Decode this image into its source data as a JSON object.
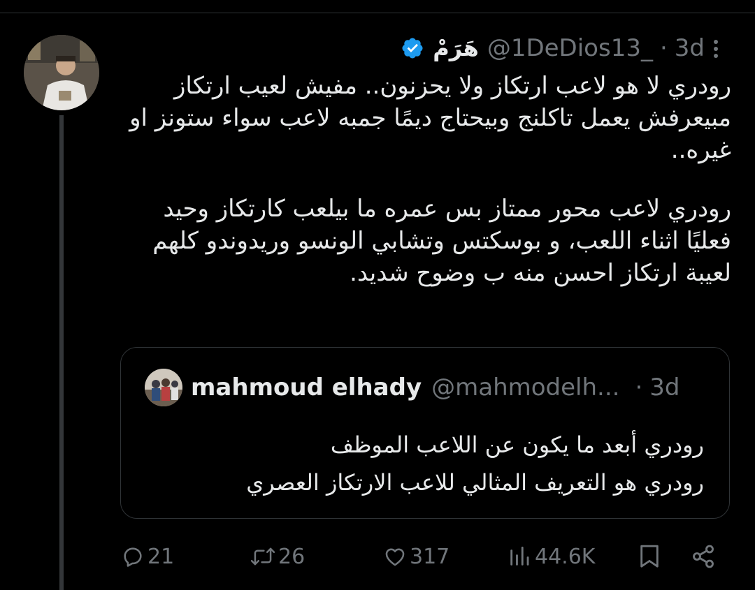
{
  "tweet": {
    "author": {
      "display_name": "هَرَمْ",
      "handle": "@1DeDios13_",
      "verified": true
    },
    "separator": "·",
    "time": "3d",
    "paragraphs": [
      "رودري لا هو لاعب ارتكاز ولا يحزنون.. مفيش لعيب ارتكاز مبيعرفش يعمل تاكلنج وبيحتاج ديمًا جمبه لاعب سواء ستونز او غيره..",
      "رودري لاعب محور ممتاز بس عمره ما بيلعب كارتكاز وحيد فعليًا اثناء اللعب، و بوسكتس وتشابي الونسو وريدوندو كلهم لعيبة ارتكاز احسن منه ب وضوح شديد."
    ]
  },
  "quote": {
    "name": "mahmoud elhady",
    "handle": "@mahmodelh...",
    "separator": "·",
    "time": "3d",
    "lines": [
      "رودري أبعد ما يكون عن اللاعب الموظف",
      "رودري هو التعريف المثالي للاعب الارتكاز العصري"
    ]
  },
  "actions": {
    "replies": "21",
    "reposts": "26",
    "likes": "317",
    "views": "44.6K"
  },
  "icons": [
    "verified-badge-icon",
    "more-options-icon",
    "reply-icon",
    "repost-icon",
    "like-icon",
    "views-icon",
    "bookmark-icon",
    "share-icon"
  ],
  "colors": {
    "background": "#000000",
    "text": "#e7e9ea",
    "muted": "#71767b",
    "border": "#2f3336",
    "verified": "#1d9bf0"
  }
}
